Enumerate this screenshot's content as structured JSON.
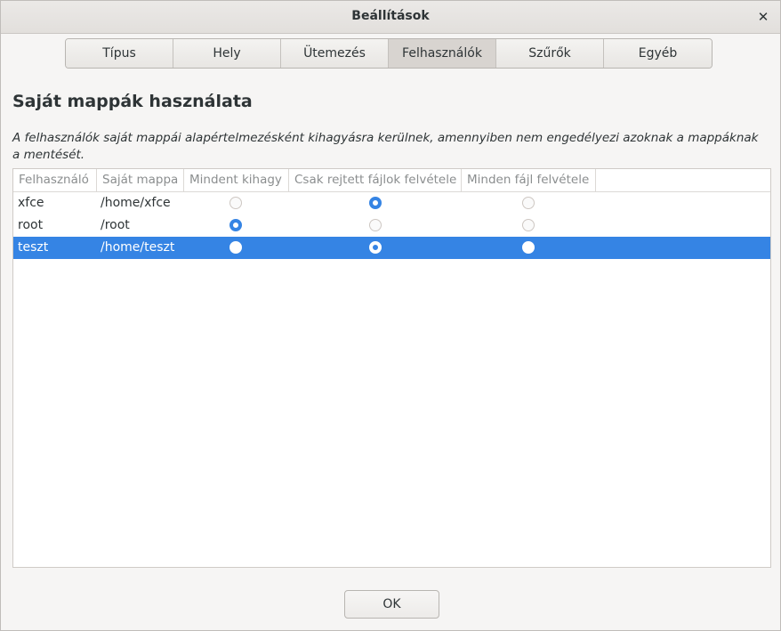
{
  "window": {
    "title": "Beállítások"
  },
  "tabs": [
    {
      "label": "Típus",
      "active": false
    },
    {
      "label": "Hely",
      "active": false
    },
    {
      "label": "Ütemezés",
      "active": false
    },
    {
      "label": "Felhasználók",
      "active": true
    },
    {
      "label": "Szűrők",
      "active": false
    },
    {
      "label": "Egyéb",
      "active": false
    }
  ],
  "section": {
    "title": "Saját mappák használata",
    "description": "A felhasználók saját mappái alapértelmezésként kihagyásra kerülnek, amennyiben nem engedélyezi azoknak a mappáknak a mentését."
  },
  "table": {
    "columns": [
      "Felhasználó",
      "Saját mappa",
      "Mindent kihagy",
      "Csak rejtett fájlok felvétele",
      "Minden fájl felvétele"
    ],
    "rows": [
      {
        "user": "xfce",
        "home": "/home/xfce",
        "choice": 1,
        "selected": false
      },
      {
        "user": "root",
        "home": "/root",
        "choice": 0,
        "selected": false
      },
      {
        "user": "teszt",
        "home": "/home/teszt",
        "choice": 1,
        "selected": true
      }
    ]
  },
  "colors": {
    "accent": "#3584e4",
    "background": "#f6f5f4"
  },
  "footer": {
    "ok_label": "OK"
  }
}
